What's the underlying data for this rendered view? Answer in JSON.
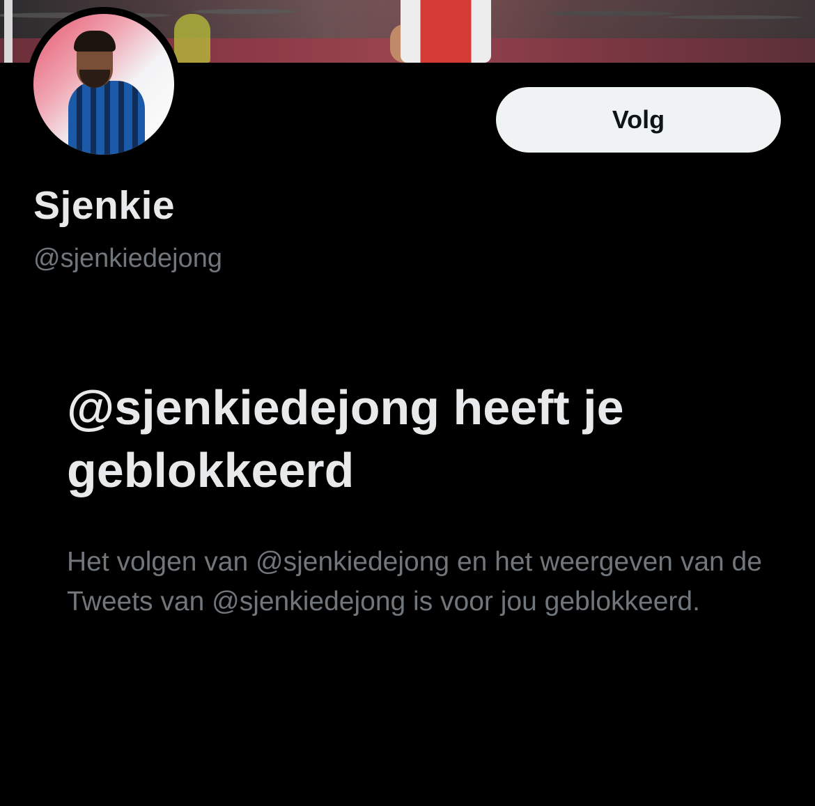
{
  "profile": {
    "display_name": "Sjenkie",
    "handle": "@sjenkiedejong",
    "follow_label": "Volg"
  },
  "blocked": {
    "title": "@sjenkiedejong heeft je geblokkeerd",
    "description": "Het volgen van @sjenkiedejong en het weergeven van de Tweets van @sjenkiedejong is voor jou geblokkeerd."
  },
  "colors": {
    "background": "#000000",
    "primary_text": "#e7e9ea",
    "secondary_text": "#71767b",
    "follow_button_bg": "#eff3f4",
    "follow_button_text": "#0f1419"
  }
}
